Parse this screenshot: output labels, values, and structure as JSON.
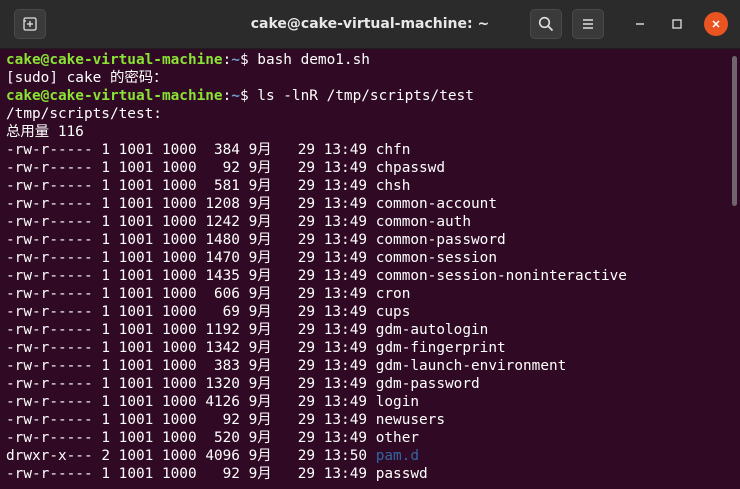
{
  "window": {
    "title": "cake@cake-virtual-machine: ~",
    "buttons": {
      "new_tab": "new-tab-icon",
      "search": "search-icon",
      "menu": "hamburger-menu-icon"
    },
    "controls": {
      "minimize": "minimize-icon",
      "maximize": "maximize-icon",
      "close": "close-icon"
    }
  },
  "colors": {
    "background": "#300a24",
    "prompt_user": "#8ae234",
    "prompt_path": "#729fcf",
    "directory": "#3465a4",
    "close_button": "#e95420"
  },
  "terminal": {
    "lines": [
      {
        "type": "prompt",
        "user": "cake@cake-virtual-machine",
        "colon": ":",
        "path": "~",
        "dollar": "$ ",
        "command": "bash demo1.sh"
      },
      {
        "type": "text",
        "text": "[sudo] cake 的密码："
      },
      {
        "type": "prompt",
        "user": "cake@cake-virtual-machine",
        "colon": ":",
        "path": "~",
        "dollar": "$ ",
        "command": "ls -lnR /tmp/scripts/test"
      },
      {
        "type": "text",
        "text": "/tmp/scripts/test:"
      },
      {
        "type": "text",
        "text": "总用量 116"
      },
      {
        "type": "file",
        "perm": "-rw-r-----",
        "links": "1",
        "uid": "1001",
        "gid": "1000",
        "size": "384",
        "month": "9月",
        "day": "29",
        "time": "13:49",
        "name": "chfn",
        "is_dir": false
      },
      {
        "type": "file",
        "perm": "-rw-r-----",
        "links": "1",
        "uid": "1001",
        "gid": "1000",
        "size": "92",
        "month": "9月",
        "day": "29",
        "time": "13:49",
        "name": "chpasswd",
        "is_dir": false
      },
      {
        "type": "file",
        "perm": "-rw-r-----",
        "links": "1",
        "uid": "1001",
        "gid": "1000",
        "size": "581",
        "month": "9月",
        "day": "29",
        "time": "13:49",
        "name": "chsh",
        "is_dir": false
      },
      {
        "type": "file",
        "perm": "-rw-r-----",
        "links": "1",
        "uid": "1001",
        "gid": "1000",
        "size": "1208",
        "month": "9月",
        "day": "29",
        "time": "13:49",
        "name": "common-account",
        "is_dir": false
      },
      {
        "type": "file",
        "perm": "-rw-r-----",
        "links": "1",
        "uid": "1001",
        "gid": "1000",
        "size": "1242",
        "month": "9月",
        "day": "29",
        "time": "13:49",
        "name": "common-auth",
        "is_dir": false
      },
      {
        "type": "file",
        "perm": "-rw-r-----",
        "links": "1",
        "uid": "1001",
        "gid": "1000",
        "size": "1480",
        "month": "9月",
        "day": "29",
        "time": "13:49",
        "name": "common-password",
        "is_dir": false
      },
      {
        "type": "file",
        "perm": "-rw-r-----",
        "links": "1",
        "uid": "1001",
        "gid": "1000",
        "size": "1470",
        "month": "9月",
        "day": "29",
        "time": "13:49",
        "name": "common-session",
        "is_dir": false
      },
      {
        "type": "file",
        "perm": "-rw-r-----",
        "links": "1",
        "uid": "1001",
        "gid": "1000",
        "size": "1435",
        "month": "9月",
        "day": "29",
        "time": "13:49",
        "name": "common-session-noninteractive",
        "is_dir": false
      },
      {
        "type": "file",
        "perm": "-rw-r-----",
        "links": "1",
        "uid": "1001",
        "gid": "1000",
        "size": "606",
        "month": "9月",
        "day": "29",
        "time": "13:49",
        "name": "cron",
        "is_dir": false
      },
      {
        "type": "file",
        "perm": "-rw-r-----",
        "links": "1",
        "uid": "1001",
        "gid": "1000",
        "size": "69",
        "month": "9月",
        "day": "29",
        "time": "13:49",
        "name": "cups",
        "is_dir": false
      },
      {
        "type": "file",
        "perm": "-rw-r-----",
        "links": "1",
        "uid": "1001",
        "gid": "1000",
        "size": "1192",
        "month": "9月",
        "day": "29",
        "time": "13:49",
        "name": "gdm-autologin",
        "is_dir": false
      },
      {
        "type": "file",
        "perm": "-rw-r-----",
        "links": "1",
        "uid": "1001",
        "gid": "1000",
        "size": "1342",
        "month": "9月",
        "day": "29",
        "time": "13:49",
        "name": "gdm-fingerprint",
        "is_dir": false
      },
      {
        "type": "file",
        "perm": "-rw-r-----",
        "links": "1",
        "uid": "1001",
        "gid": "1000",
        "size": "383",
        "month": "9月",
        "day": "29",
        "time": "13:49",
        "name": "gdm-launch-environment",
        "is_dir": false
      },
      {
        "type": "file",
        "perm": "-rw-r-----",
        "links": "1",
        "uid": "1001",
        "gid": "1000",
        "size": "1320",
        "month": "9月",
        "day": "29",
        "time": "13:49",
        "name": "gdm-password",
        "is_dir": false
      },
      {
        "type": "file",
        "perm": "-rw-r-----",
        "links": "1",
        "uid": "1001",
        "gid": "1000",
        "size": "4126",
        "month": "9月",
        "day": "29",
        "time": "13:49",
        "name": "login",
        "is_dir": false
      },
      {
        "type": "file",
        "perm": "-rw-r-----",
        "links": "1",
        "uid": "1001",
        "gid": "1000",
        "size": "92",
        "month": "9月",
        "day": "29",
        "time": "13:49",
        "name": "newusers",
        "is_dir": false
      },
      {
        "type": "file",
        "perm": "-rw-r-----",
        "links": "1",
        "uid": "1001",
        "gid": "1000",
        "size": "520",
        "month": "9月",
        "day": "29",
        "time": "13:49",
        "name": "other",
        "is_dir": false
      },
      {
        "type": "file",
        "perm": "drwxr-x---",
        "links": "2",
        "uid": "1001",
        "gid": "1000",
        "size": "4096",
        "month": "9月",
        "day": "29",
        "time": "13:50",
        "name": "pam.d",
        "is_dir": true
      },
      {
        "type": "file",
        "perm": "-rw-r-----",
        "links": "1",
        "uid": "1001",
        "gid": "1000",
        "size": "92",
        "month": "9月",
        "day": "29",
        "time": "13:49",
        "name": "passwd",
        "is_dir": false
      }
    ]
  }
}
